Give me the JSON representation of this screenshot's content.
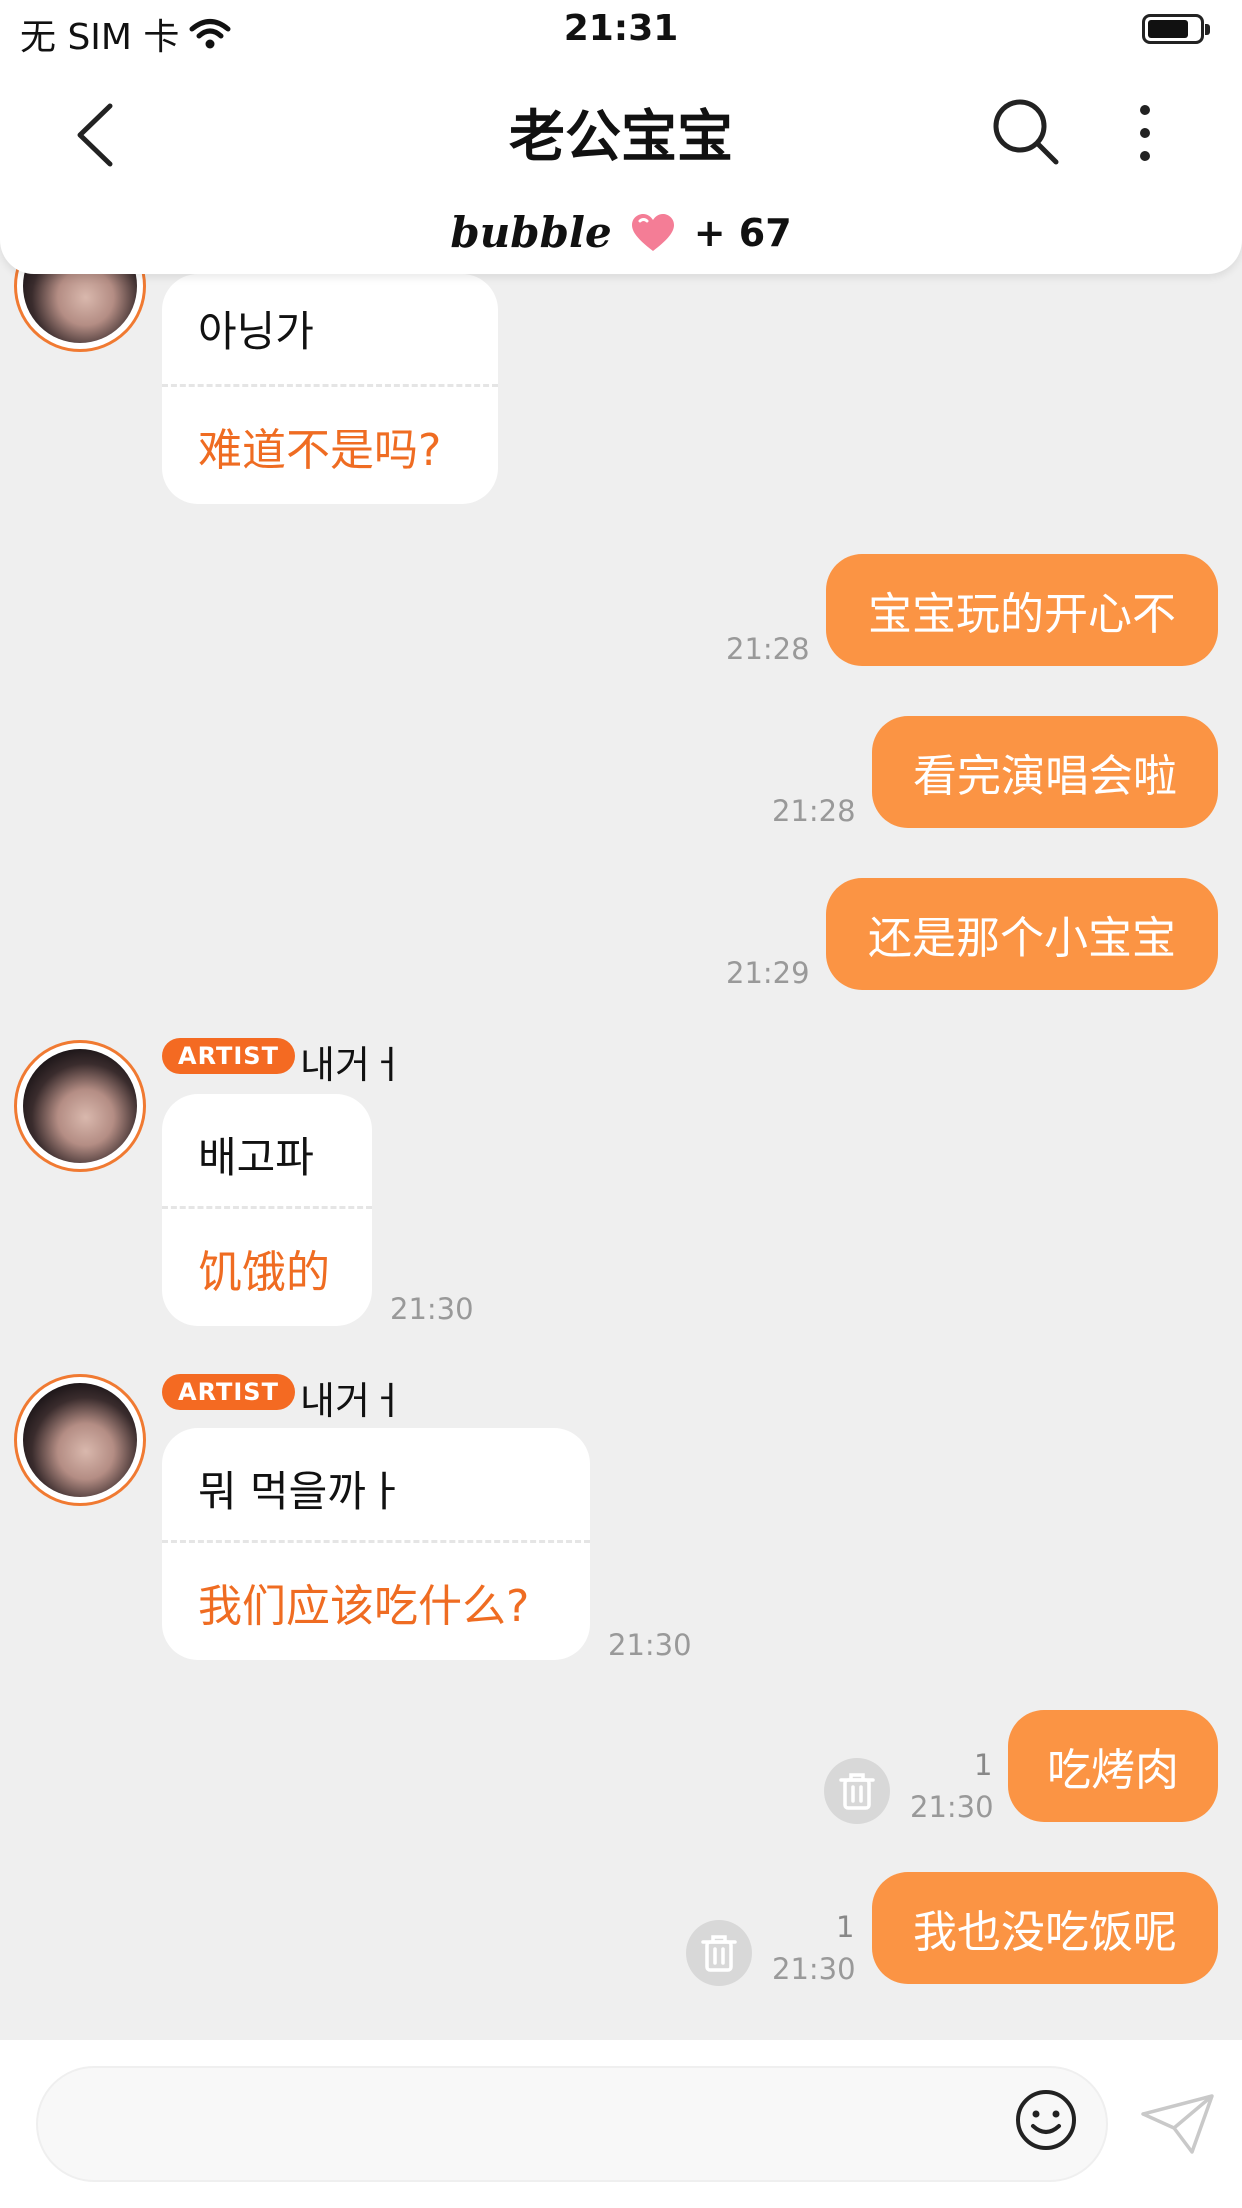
{
  "status_bar": {
    "carrier": "无 SIM 卡",
    "time": "21:31"
  },
  "header": {
    "title": "老公宝宝",
    "brand": "bubble",
    "plus_count": "+ 67"
  },
  "messages": [
    {
      "dir": "in",
      "ko": "아닝가",
      "zh": "难道不是吗?"
    },
    {
      "dir": "out",
      "text": "宝宝玩的开心不",
      "time": "21:28"
    },
    {
      "dir": "out",
      "text": "看完演唱会啦",
      "time": "21:28"
    },
    {
      "dir": "out",
      "text": "还是那个小宝宝",
      "time": "21:29"
    },
    {
      "dir": "in",
      "badge": "ARTIST",
      "sender": "내거ㅓ",
      "ko": "배고파",
      "zh": "饥饿的",
      "time": "21:30"
    },
    {
      "dir": "in",
      "badge": "ARTIST",
      "sender": "내거ㅓ",
      "ko": "뭐 먹을까ㅏ",
      "zh": "我们应该吃什么?",
      "time": "21:30"
    },
    {
      "dir": "out",
      "text": "吃烤肉",
      "time": "21:30",
      "read": "1"
    },
    {
      "dir": "out",
      "text": "我也没吃饭呢",
      "time": "21:30",
      "read": "1"
    }
  ],
  "input": {
    "placeholder": ""
  },
  "colors": {
    "accent": "#fb9444",
    "badge": "#f46a22",
    "translation": "#ef6c22",
    "background": "#efefef"
  },
  "icons": [
    "back-icon",
    "search-icon",
    "more-icon",
    "heart-icon",
    "trash-icon",
    "emoji-icon",
    "send-icon",
    "wifi-icon",
    "battery-icon"
  ]
}
